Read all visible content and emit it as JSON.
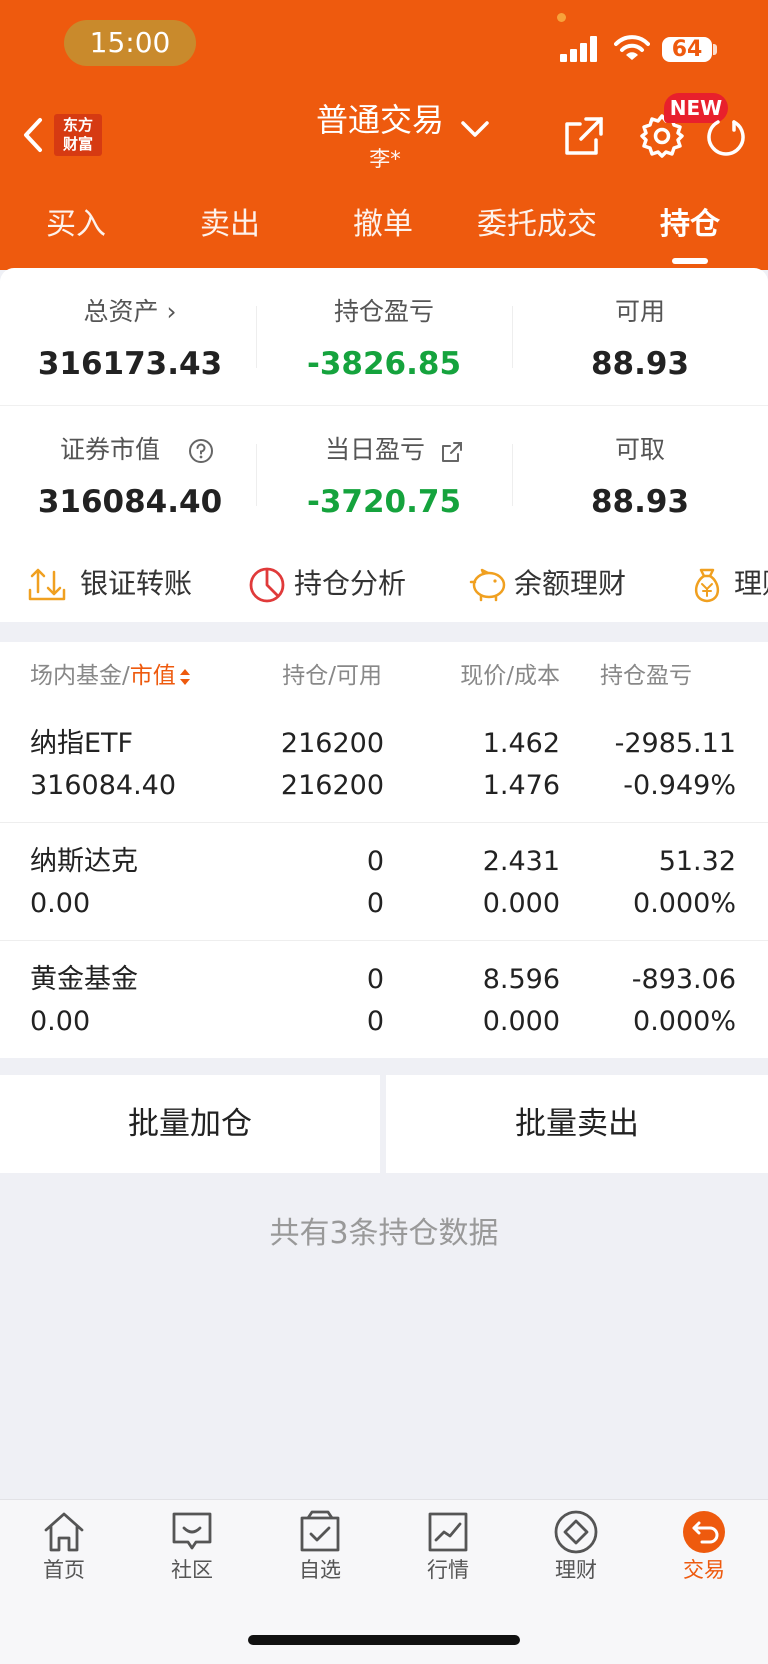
{
  "status_bar": {
    "time": "15:00",
    "battery": "64"
  },
  "header": {
    "logo_line1": "东方",
    "logo_line2": "财富",
    "title": "普通交易",
    "user": "李*",
    "new_badge": "NEW"
  },
  "tabs": [
    {
      "label": "买入"
    },
    {
      "label": "卖出"
    },
    {
      "label": "撤单"
    },
    {
      "label": "委托成交"
    },
    {
      "label": "持仓"
    }
  ],
  "summary": {
    "total_assets_label": "总资产 ›",
    "total_assets": "316173.43",
    "position_pl_label": "持仓盈亏",
    "position_pl": "-3826.85",
    "available_label": "可用",
    "available": "88.93",
    "market_value_label": "证券市值",
    "market_value": "316084.40",
    "daily_pl_label": "当日盈亏",
    "daily_pl": "-3720.75",
    "withdrawable_label": "可取",
    "withdrawable": "88.93"
  },
  "quick_actions": [
    {
      "label": "银证转账",
      "icon": "transfer-icon"
    },
    {
      "label": "持仓分析",
      "icon": "pie-chart-icon"
    },
    {
      "label": "余额理财",
      "icon": "piggy-bank-icon"
    },
    {
      "label": "理财",
      "icon": "money-bag-icon"
    }
  ],
  "table": {
    "headers": {
      "col1_prefix": "场内基金/",
      "col1_sort": "市值",
      "col2": "持仓/可用",
      "col3": "现价/成本",
      "col4": "持仓盈亏"
    },
    "rows": [
      {
        "name": "纳指ETF",
        "market_value": "316084.40",
        "position": "216200",
        "available": "216200",
        "price": "1.462",
        "cost": "1.476",
        "pl": "-2985.11",
        "pl_pct": "-0.949%"
      },
      {
        "name": "纳斯达克",
        "market_value": "0.00",
        "position": "0",
        "available": "0",
        "price": "2.431",
        "cost": "0.000",
        "pl": "51.32",
        "pl_pct": "0.000%"
      },
      {
        "name": "黄金基金",
        "market_value": "0.00",
        "position": "0",
        "available": "0",
        "price": "8.596",
        "cost": "0.000",
        "pl": "-893.06",
        "pl_pct": "0.000%"
      }
    ]
  },
  "buttons": {
    "batch_add": "批量加仓",
    "batch_sell": "批量卖出"
  },
  "footer_count": "共有3条持仓数据",
  "bottom_nav": [
    {
      "label": "首页"
    },
    {
      "label": "社区"
    },
    {
      "label": "自选"
    },
    {
      "label": "行情"
    },
    {
      "label": "理财"
    },
    {
      "label": "交易"
    }
  ],
  "colors": {
    "brand": "#ee5a0e",
    "gain": "#e02a38",
    "loss": "#15a33d"
  }
}
